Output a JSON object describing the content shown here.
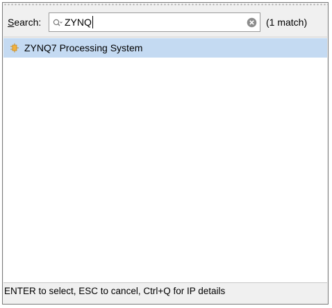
{
  "search": {
    "label_mnemonic": "S",
    "label_rest": "earch:",
    "value": "ZYNQ",
    "match_count": "(1 match)"
  },
  "results": [
    {
      "label": "ZYNQ7 Processing System",
      "icon": "ip-core-icon",
      "selected": true
    }
  ],
  "status": {
    "hint": "ENTER to select, ESC to cancel, Ctrl+Q for IP details"
  },
  "colors": {
    "selection": "#c4daf2",
    "ip_icon": "#e8a33a",
    "background": "#f0f0f0"
  }
}
